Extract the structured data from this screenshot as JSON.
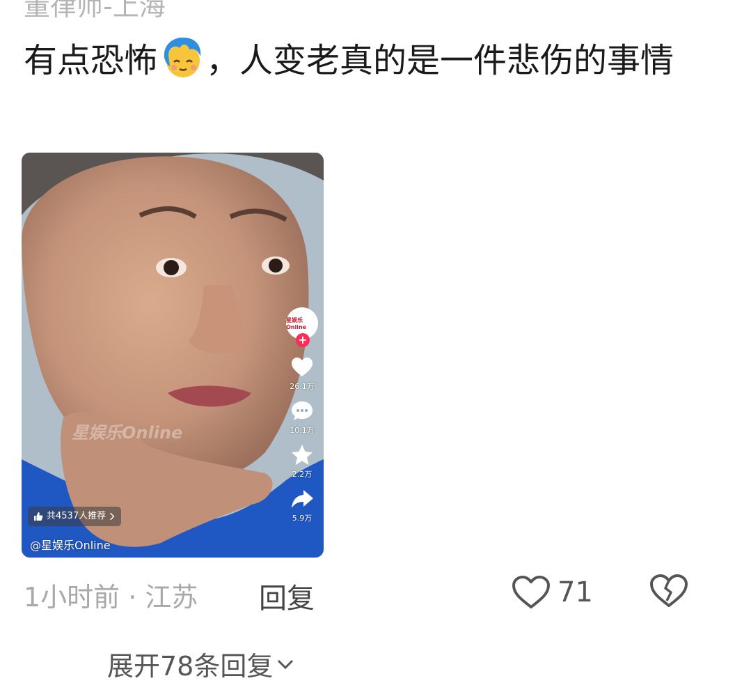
{
  "comment": {
    "author": "董律师-上海",
    "text_before_emoji": "有点恐怖",
    "emoji": "shy-face-emoji",
    "text_after_emoji": "，人变老真的是一件悲伤的事情",
    "time_location": "1小时前 · 江苏",
    "reply_label": "回复",
    "like_count": "71",
    "expand_replies_label": "展开78条回复"
  },
  "video": {
    "author_handle": "@星娱乐Online",
    "watermark": "星娱乐Online",
    "avatar_label": "星娱乐Online",
    "recommend_text": "共4537人推荐",
    "likes": "26.1万",
    "comments": "10.1万",
    "favorites": "2.2万",
    "shares": "5.9万"
  },
  "colors": {
    "accent_red": "#fe2c55",
    "muted_text": "#a8a8a8",
    "jacket_blue": "#1f57c3"
  },
  "icons": [
    "shy-face-emoji",
    "heart-icon",
    "comment-icon",
    "star-icon",
    "share-icon",
    "thumb-up-icon",
    "chevron-right-icon",
    "like-heart-icon",
    "broken-heart-icon",
    "chevron-down-icon"
  ]
}
